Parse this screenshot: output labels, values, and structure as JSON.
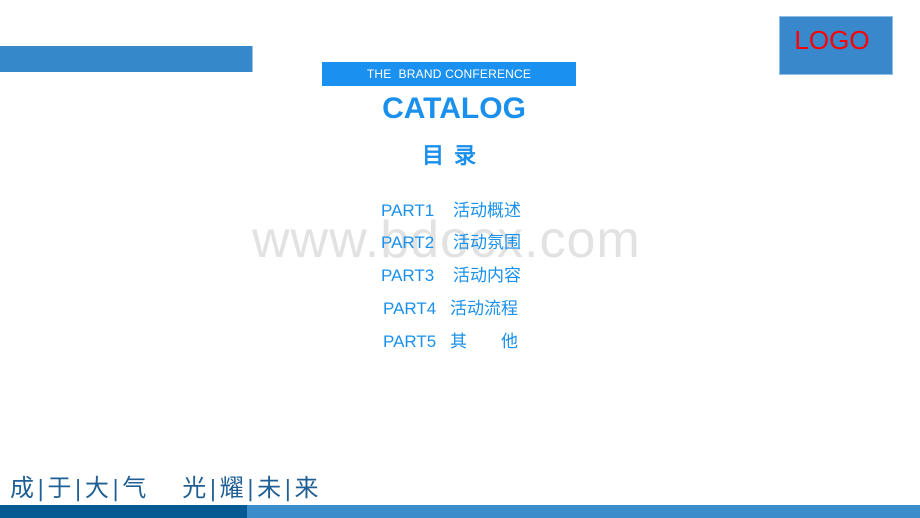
{
  "header": {
    "logo_text": "LOGO",
    "brand_strip": "THE  BRAND CONFERENCE",
    "title": "CATALOG",
    "title_cn": "目录"
  },
  "watermark": "www.bdocx.com",
  "toc": [
    {
      "part": "PART1",
      "label": "活动概述"
    },
    {
      "part": "PART2",
      "label": "活动氛围"
    },
    {
      "part": "PART3",
      "label": "活动内容"
    },
    {
      "part": "PART4",
      "label": "活动流程"
    },
    {
      "part": "PART5",
      "label": "其　　他"
    }
  ],
  "slogan": {
    "left": [
      "成",
      "于",
      "大",
      "气"
    ],
    "right": [
      "光",
      "耀",
      "未",
      "来"
    ],
    "separator": "|"
  },
  "colors": {
    "accent": "#1a90ec",
    "bar_blue": "#3589cb",
    "dark_blue": "#055a94",
    "logo_red": "#ff0000"
  }
}
